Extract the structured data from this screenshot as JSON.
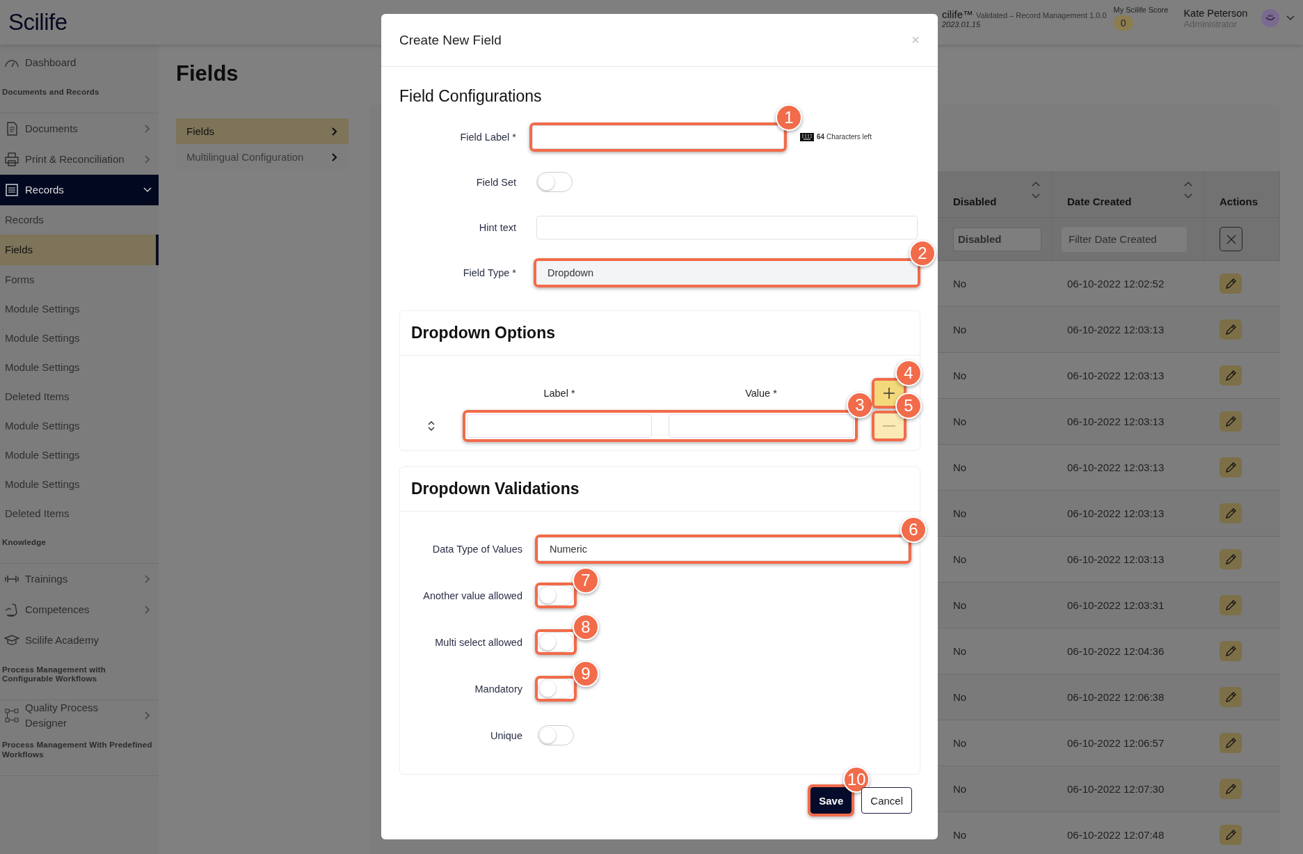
{
  "header": {
    "logo": "Scilife",
    "app_name": "cilife™",
    "app_info": "Validated – Record Management 1.0.0",
    "version": "2023.01.15",
    "score_label": "My Scilife Score",
    "score": "0",
    "user_name": "Kate Peterson",
    "user_role": "Administrator"
  },
  "sidebar": {
    "items": [
      {
        "kind": "link",
        "label": "Dashboard"
      },
      {
        "kind": "section",
        "label": "Documents and Records"
      },
      {
        "kind": "group",
        "label": "Documents",
        "expanded": false,
        "selected": false
      },
      {
        "kind": "group",
        "label": "Print & Reconciliation",
        "expanded": false,
        "selected": false
      },
      {
        "kind": "group",
        "label": "Records",
        "expanded": true,
        "selected": true
      },
      {
        "kind": "sub",
        "label": "Records",
        "selected": false
      },
      {
        "kind": "sub",
        "label": "Fields",
        "selected": true
      },
      {
        "kind": "sub",
        "label": "Forms",
        "selected": false
      },
      {
        "kind": "sub",
        "label": "Module Settings",
        "selected": false
      },
      {
        "kind": "sub",
        "label": "Module Settings",
        "selected": false
      },
      {
        "kind": "sub",
        "label": "Module Settings",
        "selected": false
      },
      {
        "kind": "sub",
        "label": "Deleted Items",
        "selected": false
      },
      {
        "kind": "sub",
        "label": "Module Settings",
        "selected": false
      },
      {
        "kind": "sub",
        "label": "Module Settings",
        "selected": false
      },
      {
        "kind": "sub",
        "label": "Module Settings",
        "selected": false
      },
      {
        "kind": "sub",
        "label": "Deleted Items",
        "selected": false
      },
      {
        "kind": "section",
        "label": "Knowledge"
      },
      {
        "kind": "group",
        "label": "Trainings",
        "expanded": false,
        "selected": false
      },
      {
        "kind": "group",
        "label": "Competences",
        "expanded": false,
        "selected": false
      },
      {
        "kind": "link",
        "label": "Scilife Academy"
      },
      {
        "kind": "section",
        "label": "Process Management with Configurable Workflows"
      },
      {
        "kind": "group",
        "label": "Quality Process Designer",
        "expanded": false,
        "selected": false
      },
      {
        "kind": "section",
        "label": "Process Management With Predefined Workflows"
      }
    ]
  },
  "page_title": "Fields",
  "subnav": [
    {
      "label": "Fields",
      "selected": true
    },
    {
      "label": "Multilingual Configuration",
      "selected": false
    }
  ],
  "table": {
    "columns": [
      {
        "label": "Disabled",
        "sortable": true
      },
      {
        "label": "Date Created",
        "sortable": true
      },
      {
        "label": "Actions"
      }
    ],
    "filters": {
      "disabled_placeholder": "Disabled",
      "date_placeholder": "Filter Date Created"
    },
    "rows": [
      {
        "disabled": "No",
        "date_created": "06-10-2022 12:02:52"
      },
      {
        "disabled": "No",
        "date_created": "06-10-2022 12:03:13"
      },
      {
        "disabled": "No",
        "date_created": "06-10-2022 12:03:13"
      },
      {
        "disabled": "No",
        "date_created": "06-10-2022 12:03:13"
      },
      {
        "disabled": "No",
        "date_created": "06-10-2022 12:03:13"
      },
      {
        "disabled": "No",
        "date_created": "06-10-2022 12:03:13"
      },
      {
        "disabled": "No",
        "date_created": "06-10-2022 12:03:13"
      },
      {
        "disabled": "No",
        "date_created": "06-10-2022 12:03:31"
      },
      {
        "disabled": "No",
        "date_created": "06-10-2022 12:04:36"
      },
      {
        "disabled": "No",
        "date_created": "06-10-2022 12:06:38"
      },
      {
        "disabled": "No",
        "date_created": "06-10-2022 12:06:57"
      },
      {
        "disabled": "No",
        "date_created": "06-10-2022 12:07:30"
      },
      {
        "disabled": "No",
        "date_created": "06-10-2022 12:07:48"
      }
    ]
  },
  "modal": {
    "title": "Create New Field",
    "close": "×",
    "config_title": "Field Configurations",
    "fields": [
      {
        "kind": "text",
        "label": "Field Label *",
        "callout": "1",
        "counter": "**64** Characters left"
      },
      {
        "kind": "toggle",
        "label": "Field Set",
        "on": false
      },
      {
        "kind": "text",
        "label": "Hint text"
      },
      {
        "kind": "select",
        "label": "Field Type *",
        "value": "Dropdown",
        "callout": "2"
      }
    ],
    "options": {
      "title": "Dropdown Options",
      "label_heading": "Label *",
      "value_heading": "Value *",
      "inputs_callout": "3",
      "add_callout": "4",
      "remove_callout": "5"
    },
    "validations": {
      "title": "Dropdown Validations",
      "fields": [
        {
          "kind": "select",
          "label": "Data Type of Values",
          "value": "Numeric",
          "callout": "6"
        },
        {
          "kind": "toggle",
          "label": "Another value allowed",
          "on": false,
          "callout": "7"
        },
        {
          "kind": "toggle",
          "label": "Multi select allowed",
          "on": false,
          "callout": "8"
        },
        {
          "kind": "toggle",
          "label": "Mandatory",
          "on": false,
          "callout": "9"
        },
        {
          "kind": "toggle",
          "label": "Unique",
          "on": false
        }
      ]
    },
    "buttons": [
      {
        "label": "Save",
        "kind": "primary",
        "callout": "10"
      },
      {
        "label": "Cancel",
        "kind": "secondary"
      }
    ]
  }
}
